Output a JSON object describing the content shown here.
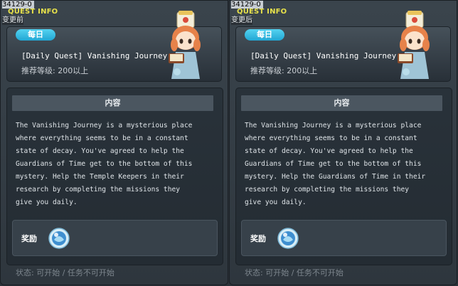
{
  "panels": [
    {
      "quest_id": "34129-0",
      "tooltip_title": "QUEST INFO",
      "variant_label": "变更前",
      "badge": "每日",
      "quest_title": "[Daily Quest] Vanishing Journey..",
      "level_text": "推荐等级: 200以上",
      "content_header": "内容",
      "description": "The Vanishing Journey is a mysterious place\nwhere everything seems to be in a constant\nstate of decay. You've agreed to help the\nGuardians of Time get to the bottom of this\nmystery. Help the Temple Keepers in their\nresearch by completing the missions they\ngive you daily.",
      "reward_label": "奖励",
      "reward_icon": "blue-orb-icon",
      "status_text": "状态: 可开始 / 任务不可开始"
    },
    {
      "quest_id": "34129-0",
      "tooltip_title": "QUEST INFO",
      "variant_label": "变更后",
      "badge": "每日",
      "quest_title": "[Daily Quest] Vanishing Journey..",
      "level_text": "推荐等级: 200以上",
      "content_header": "内容",
      "description": "The Vanishing Journey is a mysterious place\nwhere everything seems to be in a constant\nstate of decay. You've agreed to help the\nGuardians of Time get to the bottom of this\nmystery. Help the Guardians of Time in their\nresearch by completing the missions they\ngive you daily.",
      "reward_label": "奖励",
      "reward_icon": "blue-orb-icon",
      "status_text": "状态: 可开始 / 任务不可开始"
    }
  ],
  "colors": {
    "title_yellow": "#e8e24a",
    "badge_blue": "#21a7d4",
    "status_gray": "#7d868e"
  }
}
